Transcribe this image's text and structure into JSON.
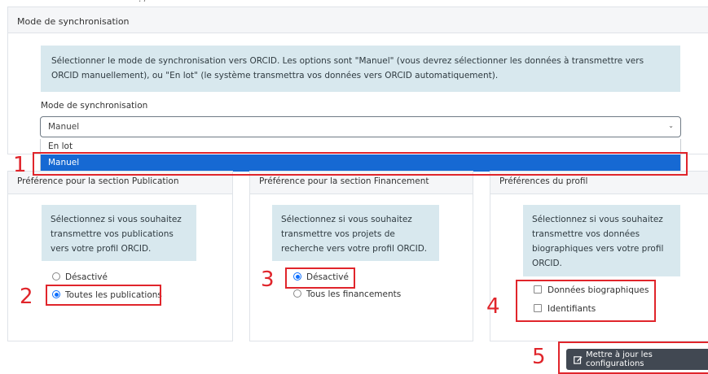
{
  "sync": {
    "card_title": "Mode de synchronisation",
    "info": "Sélectionner le mode de synchronisation vers ORCID. Les options sont \"Manuel\" (vous devrez sélectionner les données à transmettre vers ORCID manuellement), ou \"En lot\" (le système transmettra vos données vers ORCID automatiquement).",
    "field_label": "Mode de synchronisation",
    "selected": "Manuel",
    "options": [
      "En lot",
      "Manuel"
    ]
  },
  "publication": {
    "title": "Préférence pour la section Publication",
    "info": "Sélectionnez si vous souhaitez transmettre vos publications vers votre profil ORCID.",
    "options": [
      "Désactivé",
      "Toutes les publications"
    ],
    "selected_index": 1
  },
  "funding": {
    "title": "Préférence pour la section Financement",
    "info": "Sélectionnez si vous souhaitez transmettre vos projets de recherche vers votre profil ORCID.",
    "options": [
      "Désactivé",
      "Tous les financements"
    ],
    "selected_index": 0
  },
  "profile": {
    "title": "Préférences du profil",
    "info": "Sélectionnez si vous souhaitez transmettre vos données biographiques vers votre profil ORCID.",
    "options": [
      "Données biographiques",
      "Identifiants"
    ]
  },
  "actions": {
    "update_label": "Mettre à jour les configurations"
  },
  "annotations": [
    "1",
    "2",
    "3",
    "4",
    "5"
  ],
  "colors": {
    "annotation_red": "#e0252b",
    "info_bg": "#d8e8ee",
    "highlight_blue": "#1669d3",
    "button_bg": "#414852"
  }
}
